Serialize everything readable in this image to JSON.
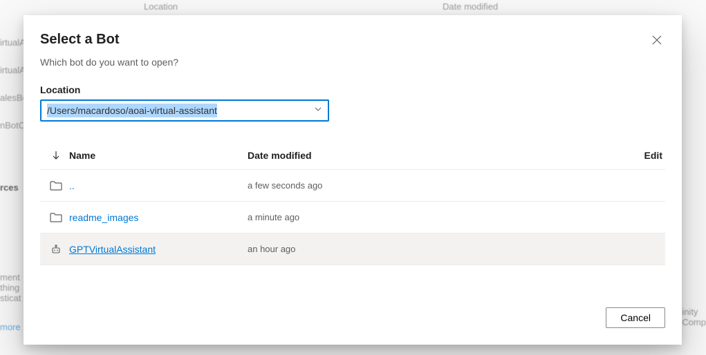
{
  "background": {
    "col_location": "Location",
    "col_date": "Date modified",
    "left_items": [
      "irtualA",
      "irtualA",
      "alesBo",
      "nBotC"
    ],
    "rces": "rces",
    "bottom": {
      "line1": "ment",
      "line2": "thing",
      "line3": "sticat",
      "learn": "more"
    },
    "right": {
      "line1": "inity",
      "line2": "Comp"
    }
  },
  "modal": {
    "title": "Select a Bot",
    "subtitle": "Which bot do you want to open?",
    "location_label": "Location",
    "location_value": "/Users/macardoso/aoai-virtual-assistant",
    "columns": {
      "name": "Name",
      "date": "Date modified",
      "edit": "Edit"
    },
    "rows": [
      {
        "icon": "folder",
        "name": "..",
        "date": "a few seconds ago"
      },
      {
        "icon": "folder",
        "name": "readme_images",
        "date": "a minute ago"
      },
      {
        "icon": "bot",
        "name": "GPTVirtualAssistant",
        "date": "an hour ago"
      }
    ],
    "cancel": "Cancel"
  }
}
